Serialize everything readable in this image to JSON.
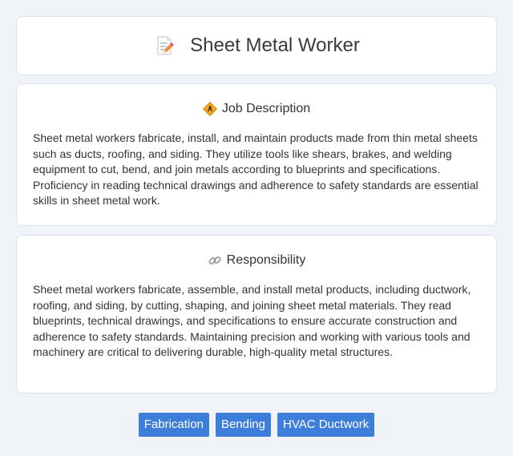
{
  "header": {
    "title": "Sheet Metal Worker",
    "icon": "memo-pencil-icon"
  },
  "job_description": {
    "title": "Job Description",
    "icon": "worker-sign-icon",
    "text": "Sheet metal workers fabricate, install, and maintain products made from thin metal sheets such as ducts, roofing, and siding. They utilize tools like shears, brakes, and welding equipment to cut, bend, and join metals according to blueprints and specifications. Proficiency in reading technical drawings and adherence to safety standards are essential skills in sheet metal work."
  },
  "responsibility": {
    "title": "Responsibility",
    "icon": "link-icon",
    "text": "Sheet metal workers fabricate, assemble, and install metal products, including ductwork, roofing, and siding, by cutting, shaping, and joining sheet metal materials. They read blueprints, technical drawings, and specifications to ensure accurate construction and adherence to safety standards. Maintaining precision and working with various tools and machinery are critical to delivering durable, high-quality metal structures."
  },
  "tags": [
    "Fabrication",
    "Bending",
    "HVAC Ductwork"
  ],
  "colors": {
    "tag_bg": "#3d7edb",
    "page_bg": "#f0f4f9"
  }
}
